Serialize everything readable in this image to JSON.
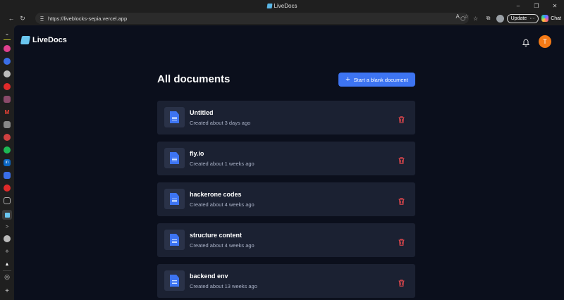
{
  "window": {
    "title": "LiveDocs",
    "controls": [
      "–",
      "❐",
      "✕"
    ]
  },
  "browser": {
    "url": "https://liveblocks-sepia.vercel.app",
    "update_label": "Update",
    "update_more": "···",
    "chat_label": "Chat"
  },
  "app": {
    "brand": "LiveDocs",
    "user_initial": "T",
    "heading": "All documents",
    "new_doc_label": "Start a blank document",
    "documents": [
      {
        "title": "Untitled",
        "created": "Created about 3 days ago"
      },
      {
        "title": "fly.io",
        "created": "Created about 1 weeks ago"
      },
      {
        "title": "hackerone codes",
        "created": "Created about 4 weeks ago"
      },
      {
        "title": "structure content",
        "created": "Created about 4 weeks ago"
      },
      {
        "title": "backend env",
        "created": "Created about 13 weeks ago"
      }
    ]
  },
  "colors": {
    "accent": "#3d74f2",
    "background": "#0b0f1c",
    "card": "#1b2132",
    "delete": "#e5484d",
    "avatar": "#f47a16"
  }
}
